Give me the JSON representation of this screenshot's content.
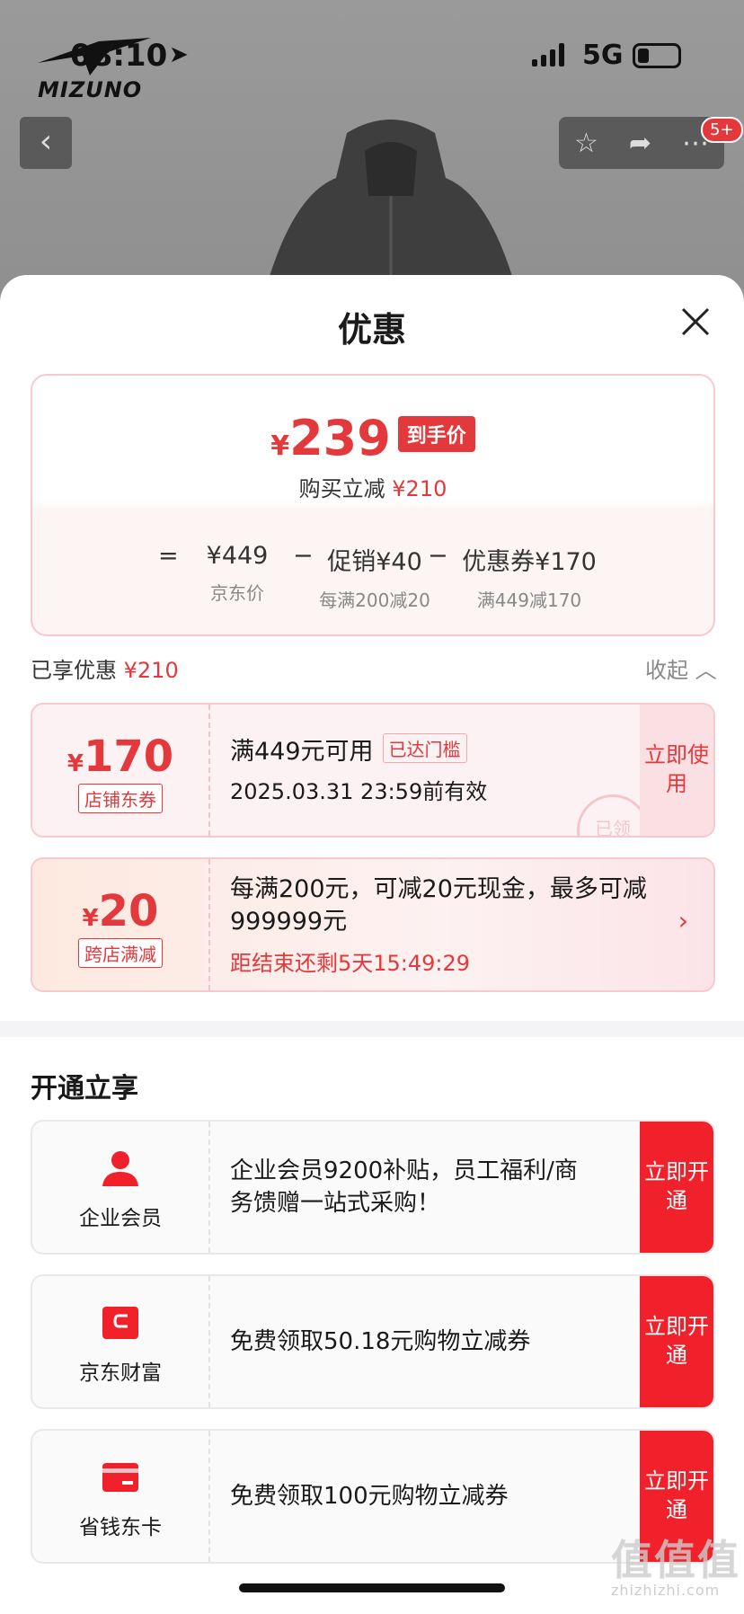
{
  "status_bar": {
    "time": "08:10",
    "network": "5G"
  },
  "brand": {
    "logo_text": "MIZUNO"
  },
  "header": {
    "badge": "5+"
  },
  "sheet": {
    "title": "优惠"
  },
  "price": {
    "currency": "¥",
    "final": "239",
    "final_tag": "到手价",
    "reduce_label": "购买立减",
    "reduce_value": "¥210",
    "jd_price": "¥449",
    "jd_price_label": "京东价",
    "promo": "促销¥40",
    "promo_label": "每满200减20",
    "coupon": "优惠券¥170",
    "coupon_label": "满449减170"
  },
  "enjoyed": {
    "label": "已享优惠",
    "value": "¥210",
    "collapse": "收起"
  },
  "coupons": [
    {
      "currency": "¥",
      "amount": "170",
      "type": "店铺东券",
      "condition": "满449元可用",
      "tag": "已达门槛",
      "validity": "2025.03.31 23:59前有效",
      "action": "立即使用",
      "stamp": "已领"
    },
    {
      "currency": "¥",
      "amount": "20",
      "type": "跨店满减",
      "condition": "每满200元，可减20元现金，最多可减999999元",
      "countdown": "距结束还剩5天15:49:29"
    }
  ],
  "membership": {
    "title": "开通立享",
    "items": [
      {
        "label": "企业会员",
        "text": "企业会员9200补贴，员工福利/商务馈赠一站式采购！",
        "action": "立即开通"
      },
      {
        "label": "京东财富",
        "text": "免费领取50.18元购物立减券",
        "action": "立即开通"
      },
      {
        "label": "省钱东卡",
        "text": "免费领取100元购物立减券",
        "action": "立即开通"
      }
    ]
  },
  "watermark": {
    "main": "值值值",
    "sub": "zhizhizhi.com"
  },
  "colors": {
    "accent": "#e4393c",
    "button_red": "#f0212b"
  }
}
